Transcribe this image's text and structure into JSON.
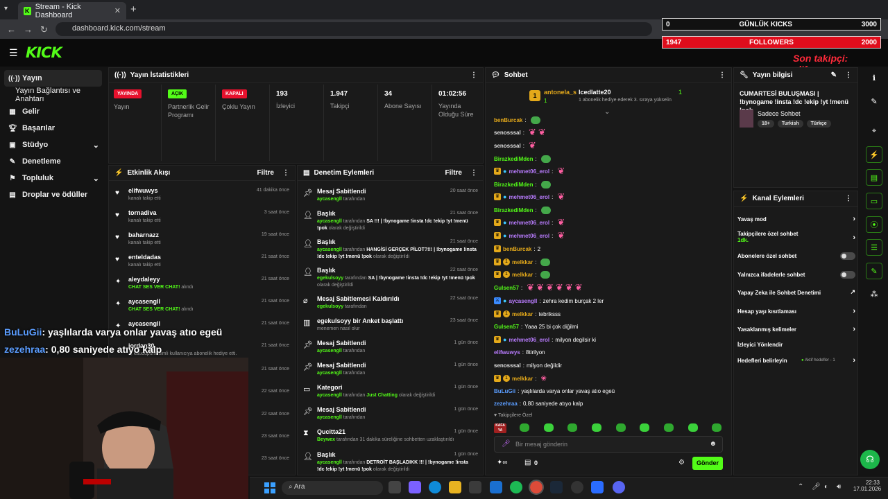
{
  "browser": {
    "tab_title": "Stream - Kick Dashboard",
    "url": "dashboard.kick.com/stream"
  },
  "overlay": {
    "kicks_left": "0",
    "kicks_label": "GÜNLÜK KICKS",
    "kicks_goal": "3000",
    "followers_left": "1947",
    "followers_label": "FOLLOWERS",
    "followers_goal": "2000",
    "last_follower": "Son takipçi: elifwuwys"
  },
  "brand": {
    "logo": "KICK",
    "accent": "#53fc18"
  },
  "sidebar": {
    "items": [
      {
        "label": "Yayın",
        "icon": "broadcast-icon"
      },
      {
        "label": "Yayın Bağlantısı ve Anahtarı"
      },
      {
        "label": "Gelir",
        "icon": "revenue-icon"
      },
      {
        "label": "Başarılar",
        "icon": "trophy-icon"
      },
      {
        "label": "Stüdyo",
        "icon": "studio-icon"
      },
      {
        "label": "Denetleme",
        "icon": "wrench-icon"
      },
      {
        "label": "Topluluk",
        "icon": "community-icon"
      },
      {
        "label": "Droplar ve ödüller",
        "icon": "drops-icon"
      }
    ]
  },
  "stats": {
    "title": "Yayın İstatistikleri",
    "items": [
      {
        "tag": "YAYINDA",
        "label": "Yayın"
      },
      {
        "tag": "AÇIK",
        "label": "Partnerlik Gelir Programı"
      },
      {
        "tag": "KAPALI",
        "label": "Çoklu Yayın"
      },
      {
        "value": "193",
        "label": "İzleyici"
      },
      {
        "value": "1.947",
        "label": "Takipçi"
      },
      {
        "value": "34",
        "label": "Abone Sayısı"
      },
      {
        "value": "01:02:56",
        "label": "Yayında Olduğu Süre"
      }
    ]
  },
  "activity": {
    "title": "Etkinlik Akışı",
    "filter": "Filtre",
    "rows": [
      {
        "name": "elifwuwys",
        "sub": "kanalı takip etti",
        "time": "41 dakika önce"
      },
      {
        "name": "tornadiva",
        "sub": "kanalı takip etti",
        "time": "3 saat önce"
      },
      {
        "name": "baharnazz",
        "sub": "kanalı takip etti",
        "time": "19 saat önce"
      },
      {
        "name": "enteldadas",
        "sub": "kanalı takip etti",
        "time": "21 saat önce"
      },
      {
        "name": "aleydaleyy",
        "sub": "CHAT SES VER CHAT!",
        "sub2": "alındı",
        "time": "21 saat önce"
      },
      {
        "name": "aycasengll",
        "sub": "CHAT SES VER CHAT!",
        "sub2": "alındı",
        "time": "21 saat önce"
      },
      {
        "name": "aycasengll",
        "sub": "",
        "time": "21 saat önce"
      },
      {
        "name": "jordan30",
        "sub": "1, kaudupuni isimli kullanıcıya abonelik hediye etti.",
        "time": "21 saat önce"
      }
    ],
    "extra_times": [
      "21 saat önce",
      "22 saat önce",
      "22 saat önce",
      "23 saat önce",
      "23 saat önce"
    ]
  },
  "caption": {
    "l1_user": "BuLuGii",
    "l1_text": ": yaşlılarda varya onlar yavaş atıo egeü",
    "l2_user": "zezehraa",
    "l2_text": ": 0,80 saniyede atıyo kalp"
  },
  "moderation": {
    "title": "Denetim Eylemleri",
    "filter": "Filtre",
    "rows": [
      {
        "name": "Mesaj Sabitlendi",
        "by": "aycasengll",
        "rest": "tarafından",
        "time": "20 saat önce"
      },
      {
        "name": "Başlık",
        "by": "aycasengll",
        "mid": "tarafından",
        "title": "SA !!! | !bynogame !insta !dc !ekip !yt !menü !pok",
        "end": "olarak değiştirildi",
        "time": "21 saat önce"
      },
      {
        "name": "Başlık",
        "by": "aycasengll",
        "mid": "tarafından",
        "title": "HANGİSİ GERÇEK PİLOT?!!! | !bynogame !insta !dc !ekip !yt !menü !pok",
        "end": "olarak değiştirildi",
        "time": "21 saat önce"
      },
      {
        "name": "Başlık",
        "by": "egekulsoyy",
        "mid": "tarafından",
        "title": "SA | !bynogame !insta !dc !ekip !yt !menü !pok",
        "end": "olarak değiştirildi",
        "time": "22 saat önce"
      },
      {
        "name": "Mesaj Sabitlemesi Kaldırıldı",
        "by": "egekulsoyy",
        "rest": "tarafından",
        "time": "22 saat önce"
      },
      {
        "name": "egekulsoyy bir Anket başlattı",
        "by": "",
        "rest": "menemen nasıl olur",
        "time": "23 saat önce"
      },
      {
        "name": "Mesaj Sabitlendi",
        "by": "aycasengll",
        "rest": "tarafından",
        "time": "1 gün önce"
      },
      {
        "name": "Mesaj Sabitlendi",
        "by": "aycasengll",
        "rest": "tarafından",
        "time": "1 gün önce"
      },
      {
        "name": "Kategori",
        "by": "aycasengll",
        "mid": "tarafından",
        "title": "Just Chatting",
        "end": "olarak değiştirildi",
        "time": "1 gün önce"
      },
      {
        "name": "Mesaj Sabitlendi",
        "by": "aycasengll",
        "rest": "tarafından",
        "time": "1 gün önce"
      },
      {
        "name": "Qucitta21",
        "by": "Beywex",
        "rest": "tarafından 31 dakika süreliğine sohbetten uzaklaştırıldı",
        "time": "1 gün önce"
      },
      {
        "name": "Başlık",
        "by": "aycasengll",
        "mid": "tarafından",
        "title": "DETROİT BAŞLADIKK !!! | !bynogame !insta !dc !ekip !yt !menü !pok",
        "end": "olarak değiştirildi",
        "time": "1 gün önce"
      }
    ]
  },
  "chat": {
    "title": "Sohbet",
    "pin_user1": "antonela_s",
    "pin_count1": "1",
    "pin_user2": "Icedlatte20",
    "pin_count2": "1",
    "pin_note": "1 abonelik hediye ederek 3. sıraya yükselin",
    "messages": [
      {
        "user": "benBurcak",
        "color": "#e4a91a",
        "text": ""
      },
      {
        "user": "senosssal",
        "color": "#e0e0e0",
        "text": ""
      },
      {
        "user": "senosssal",
        "color": "#e0e0e0",
        "text": ""
      },
      {
        "user": "BirazkediMden",
        "color": "#53fc18",
        "text": ""
      },
      {
        "user": "mehmet06_erol",
        "color": "#b97cff",
        "text": ""
      },
      {
        "user": "BirazkediMden",
        "color": "#53fc18",
        "text": ""
      },
      {
        "user": "mehmet06_erol",
        "color": "#b97cff",
        "text": ""
      },
      {
        "user": "BirazkediMden",
        "color": "#53fc18",
        "text": ""
      },
      {
        "user": "mehmet06_erol",
        "color": "#b97cff",
        "text": ""
      },
      {
        "user": "mehmet06_erol",
        "color": "#b97cff",
        "text": ""
      },
      {
        "user": "benBurcak",
        "color": "#e4a91a",
        "text": "2"
      },
      {
        "user": "melkkar",
        "color": "#e4a91a",
        "text": ""
      },
      {
        "user": "melkkar",
        "color": "#e4a91a",
        "text": ""
      },
      {
        "user": "Gulsen57",
        "color": "#53fc18",
        "text": ""
      },
      {
        "user": "aycasengll",
        "color": "#b97cff",
        "text": "zehra kedim burçak 2 ler"
      },
      {
        "user": "melkkar",
        "color": "#e4a91a",
        "text": "tebriksss"
      },
      {
        "user": "Gulsen57",
        "color": "#53fc18",
        "text": "Yaaa 25 bi çok diğilmi"
      },
      {
        "user": "mehmet06_erol",
        "color": "#b97cff",
        "text": "milyon degilsir ki"
      },
      {
        "user": "elifwuwys",
        "color": "#b97cff",
        "text": "8tirilyon"
      },
      {
        "user": "senosssal",
        "color": "#e0e0e0",
        "text": "milyon değildir"
      },
      {
        "user": "melkkar",
        "color": "#e4a91a",
        "text": ""
      },
      {
        "user": "BuLuGii",
        "color": "#5b9dff",
        "text": "yaşlılarda varya onlar yavaş atıo egeü"
      },
      {
        "user": "zezehraa",
        "color": "#5b9dff",
        "text": "0,80 saniyede atıyo kalp"
      }
    ],
    "followers_only": "Takipçilere Özel",
    "emote_label": "KAFA YA",
    "placeholder": "Bir mesaj gönderin",
    "count": "0",
    "send": "Gönder"
  },
  "stream_info": {
    "title": "Yayın bilgisi",
    "stream_title": "CUMARTESİ BULUŞMASI | !bynogame !insta !dc !ekip !yt !menü !pok",
    "category": "Sadece Sohbet",
    "tags": [
      "18+",
      "Turkish",
      "Türkçe"
    ]
  },
  "channel_actions": {
    "title": "Kanal Eylemleri",
    "items": [
      {
        "label": "Yavaş mod",
        "kind": "chevron"
      },
      {
        "label": "Takipçilere özel sohbet",
        "sub": "1dk.",
        "kind": "chevron"
      },
      {
        "label": "Abonelere özel sohbet",
        "kind": "toggle"
      },
      {
        "label": "Yalnızca ifadelerle sohbet",
        "kind": "toggle"
      },
      {
        "label": "Yapay Zeka ile Sohbet Denetimi",
        "kind": "ext"
      },
      {
        "label": "Hesap yaşı kısıtlaması",
        "kind": "chevron"
      },
      {
        "label": "Yasaklanmış kelimeler",
        "kind": "chevron"
      },
      {
        "label": "İzleyici Yönlendir",
        "kind": ""
      },
      {
        "label": "Hedefleri belirleyin",
        "sub": "Aktif hedefler - 1",
        "kind": "chevron"
      }
    ]
  },
  "taskbar": {
    "search": "Ara",
    "time": "22:33",
    "date": "17.01.2026"
  }
}
